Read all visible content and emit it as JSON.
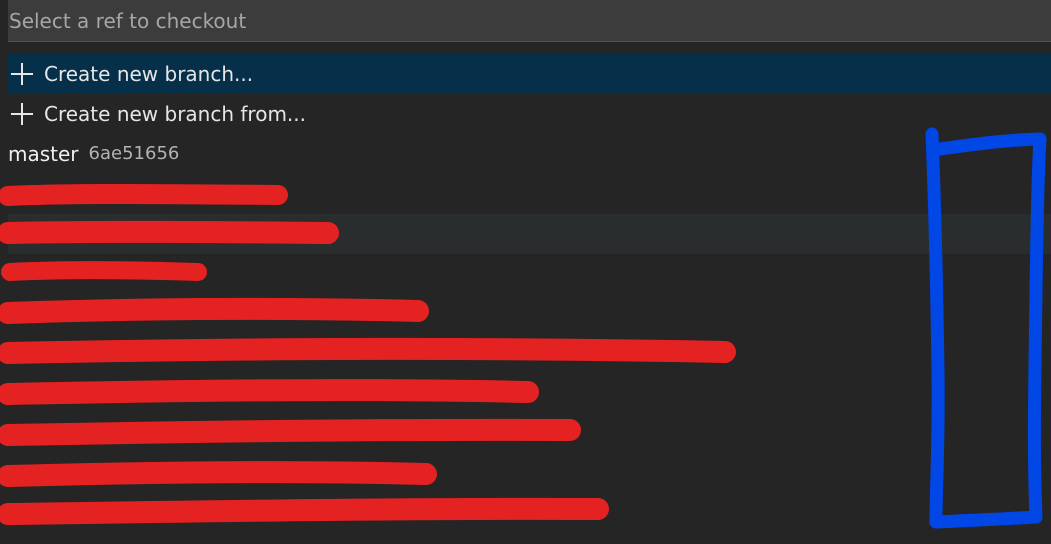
{
  "quick_pick": {
    "placeholder": "Select a ref to checkout",
    "value": "",
    "items": [
      {
        "type": "action",
        "icon": "plus-icon",
        "label": "Create new branch..."
      },
      {
        "type": "action",
        "icon": "plus-icon",
        "label": "Create new branch from..."
      },
      {
        "type": "branch",
        "label": "master",
        "commit": "6ae51656"
      }
    ]
  },
  "colors": {
    "background": "#252526",
    "input_background": "#3c3c3c",
    "focus_border": "#0e639c",
    "selected_row": "#062f4a",
    "hover_row": "#2a2d2e",
    "redaction_red": "#e52222",
    "annotation_blue": "#0047e6"
  }
}
